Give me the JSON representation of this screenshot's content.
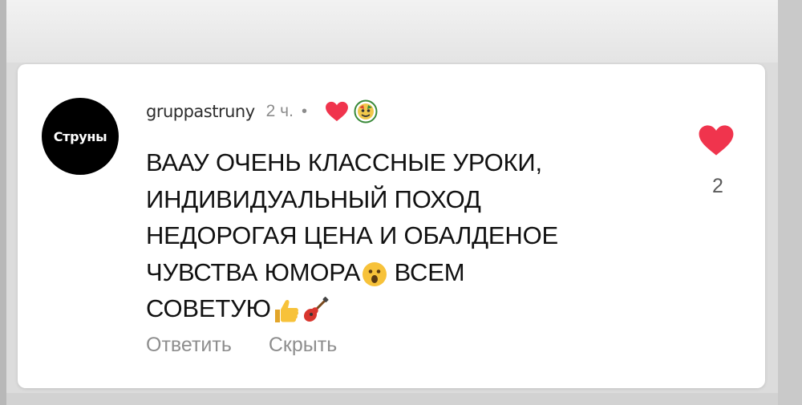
{
  "comment": {
    "avatar_text": "Струны",
    "username": "gruppastruny",
    "time": "2 ч.",
    "separator": "•",
    "text_lines": [
      "ВААУ ОЧЕНЬ КЛАССНЫЕ УРОКИ,",
      "ИНДИВИДУАЛЬНЫЙ ПОХОД",
      "НЕДОРОГАЯ ЦЕНА И ОБАЛДЕНОЕ",
      "ЧУВСТВА ЮМОРА",
      "ВСЕМ",
      "СОВЕТУЮ"
    ],
    "emojis": {
      "surprised": "surprised-face-icon",
      "thumbs_up": "thumbs-up-icon",
      "guitar": "guitar-icon",
      "author_reaction": "author-reaction-face-icon"
    },
    "actions": {
      "reply": "Ответить",
      "hide": "Скрыть"
    },
    "like_count": "2",
    "colors": {
      "heart": "#f0344d",
      "secondary_text": "#8e8e8e"
    }
  }
}
